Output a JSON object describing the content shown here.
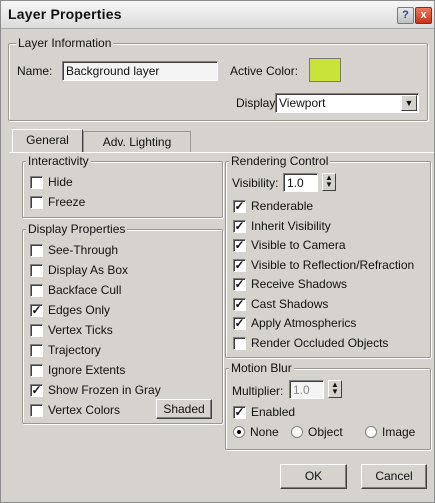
{
  "window": {
    "title": "Layer Properties",
    "help_icon": "?",
    "close_icon": "x"
  },
  "layer_info": {
    "group_label": "Layer Information",
    "name_label": "Name:",
    "name_value": "Background layer",
    "active_color_label": "Active Color:",
    "active_color": "#c9e33a",
    "display_label": "Display:",
    "display_value": "Viewport"
  },
  "tabs": [
    {
      "label": "General",
      "active": true
    },
    {
      "label": "Adv. Lighting",
      "active": false
    }
  ],
  "interactivity": {
    "group_label": "Interactivity",
    "items": [
      {
        "label": "Hide",
        "checked": false
      },
      {
        "label": "Freeze",
        "checked": false
      }
    ]
  },
  "display_properties": {
    "group_label": "Display Properties",
    "items": [
      {
        "label": "See-Through",
        "checked": false
      },
      {
        "label": "Display As Box",
        "checked": false
      },
      {
        "label": "Backface Cull",
        "checked": false
      },
      {
        "label": "Edges Only",
        "checked": true
      },
      {
        "label": "Vertex Ticks",
        "checked": false
      },
      {
        "label": "Trajectory",
        "checked": false
      },
      {
        "label": "Ignore Extents",
        "checked": false
      },
      {
        "label": "Show Frozen in Gray",
        "checked": true
      },
      {
        "label": "Vertex Colors",
        "checked": false
      }
    ],
    "shaded_button": "Shaded"
  },
  "rendering_control": {
    "group_label": "Rendering Control",
    "visibility_label": "Visibility:",
    "visibility_value": "1.0",
    "items": [
      {
        "label": "Renderable",
        "checked": true
      },
      {
        "label": "Inherit Visibility",
        "checked": true
      },
      {
        "label": "Visible to Camera",
        "checked": true
      },
      {
        "label": "Visible to Reflection/Refraction",
        "checked": true
      },
      {
        "label": "Receive Shadows",
        "checked": true
      },
      {
        "label": "Cast Shadows",
        "checked": true
      },
      {
        "label": "Apply Atmospherics",
        "checked": true
      },
      {
        "label": "Render Occluded Objects",
        "checked": false
      }
    ]
  },
  "motion_blur": {
    "group_label": "Motion Blur",
    "multiplier_label": "Multiplier:",
    "multiplier_value": "1.0",
    "enabled_label": "Enabled",
    "enabled_checked": true,
    "options": [
      {
        "label": "None",
        "selected": true
      },
      {
        "label": "Object",
        "selected": false
      },
      {
        "label": "Image",
        "selected": false
      }
    ]
  },
  "buttons": {
    "ok": "OK",
    "cancel": "Cancel"
  }
}
